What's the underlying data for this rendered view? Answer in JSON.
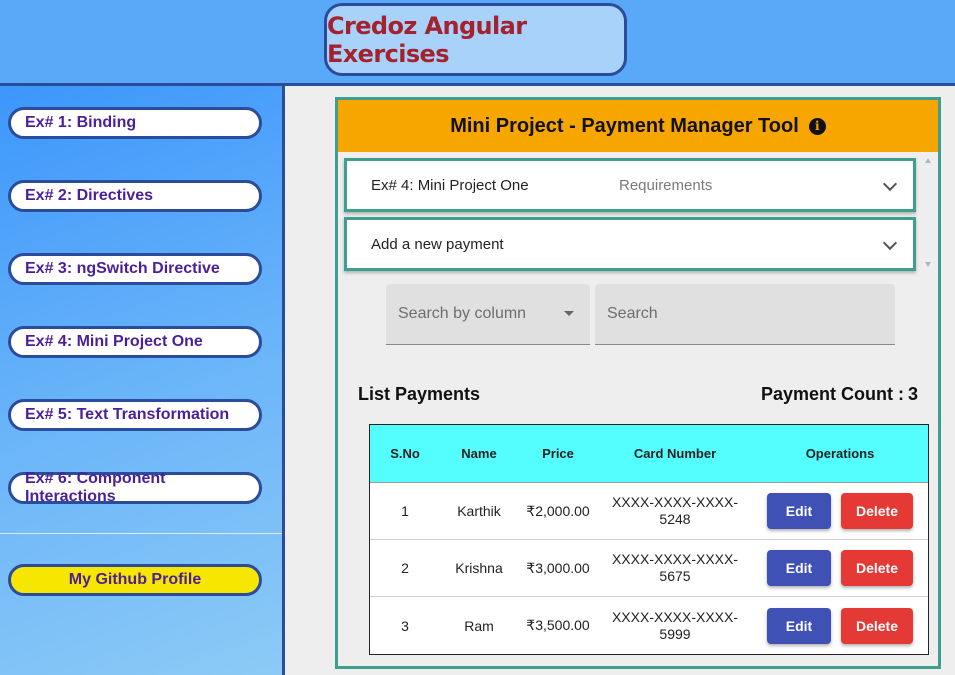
{
  "header": {
    "title": "Credoz Angular Exercises"
  },
  "sidebar": {
    "items": [
      {
        "label": "Ex# 1: Binding"
      },
      {
        "label": "Ex# 2: Directives"
      },
      {
        "label": "Ex# 3: ngSwitch Directive"
      },
      {
        "label": "Ex# 4: Mini Project One"
      },
      {
        "label": "Ex# 5: Text Transformation"
      },
      {
        "label": "Ex# 6: Component Interactions"
      }
    ],
    "github_label": "My Github Profile"
  },
  "project": {
    "title": "Mini Project - Payment Manager Tool",
    "info_icon": "info-icon",
    "panels": [
      {
        "title": "Ex# 4: Mini Project One",
        "description": "Requirements"
      },
      {
        "title": "Add a new payment",
        "description": ""
      }
    ],
    "search": {
      "column_placeholder": "Search by column",
      "text_placeholder": "Search"
    },
    "list_title": "List Payments",
    "count_label": "Payment Count :",
    "count_value": "3",
    "table": {
      "headers": [
        "S.No",
        "Name",
        "Price",
        "Card Number",
        "Operations"
      ],
      "rows": [
        {
          "sno": "1",
          "name": "Karthik",
          "price": "₹2,000.00",
          "card_line1": "XXXX-XXXX-XXXX-",
          "card_line2": "5248"
        },
        {
          "sno": "2",
          "name": "Krishna",
          "price": "₹3,000.00",
          "card_line1": "XXXX-XXXX-XXXX-",
          "card_line2": "5675"
        },
        {
          "sno": "3",
          "name": "Ram",
          "price": "₹3,500.00",
          "card_line1": "XXXX-XXXX-XXXX-",
          "card_line2": "5999"
        }
      ],
      "edit_label": "Edit",
      "delete_label": "Delete"
    }
  },
  "colors": {
    "header_bg": "#5aa8f8",
    "title_text": "#a3222d",
    "accent_border": "#2b4c9b",
    "project_header": "#f7a600",
    "table_header": "#55fefe",
    "edit_button": "#3f51b5",
    "delete_button": "#e53935",
    "github_button": "#f7e700"
  }
}
